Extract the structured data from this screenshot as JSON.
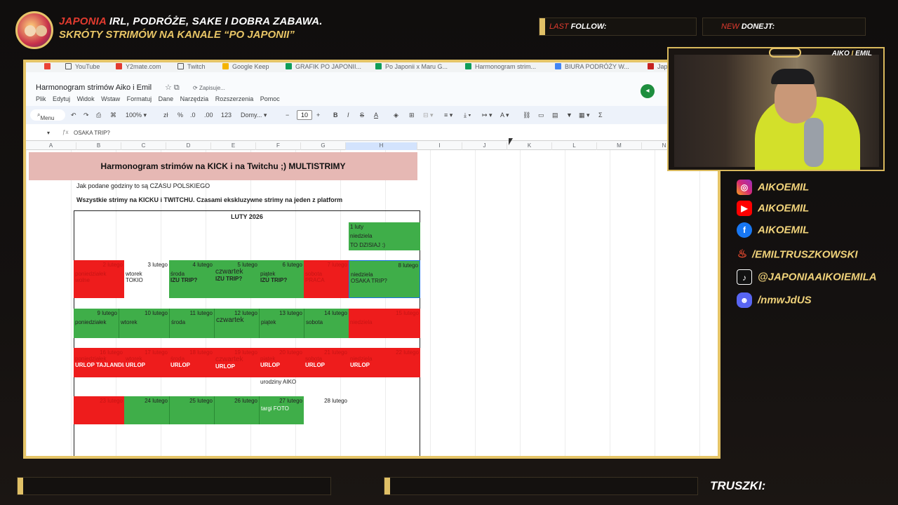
{
  "overlay": {
    "title_red": "JAPONIA",
    "title_rest": " IRL, PODRÓŻE, SAKE I DOBRA ZABAWA.",
    "subtitle": "SKRÓTY STRIMÓW NA KANALE “PO JAPONII”",
    "last_follow_a": "LAST",
    "last_follow_b": "FOLLOW:",
    "donate_a": "NEW",
    "donate_b": "DONEJT:",
    "truszki": "TRUSZKI:",
    "colors": {
      "accent": "#e6c46a",
      "red": "#e23b2f"
    }
  },
  "webcam": {
    "tag_a": "AIKO",
    "tag_mid": " I ",
    "tag_b": "EMIL"
  },
  "socials": [
    {
      "icon": "instagram-icon",
      "handle": "AIKOEMIL"
    },
    {
      "icon": "youtube-icon",
      "handle": "AIKOEMIL"
    },
    {
      "icon": "facebook-icon",
      "handle": "AIKOEMIL"
    },
    {
      "icon": "fire-icon",
      "handle": "/EMILTRUSZKOWSKI"
    },
    {
      "icon": "tiktok-icon",
      "handle": "@JAPONIAAIKOIEMILA"
    },
    {
      "icon": "discord-icon",
      "handle": "/nmwJdUS"
    }
  ],
  "browser": {
    "bookmarks": [
      "YouTube",
      "Y2mate.com",
      "Twitch",
      "Google Keep",
      "GRAFIK PO JAPONII...",
      "Po Japonii x Maru G...",
      "Harmonogram strim...",
      "BIURA PODRÓŻY W...",
      "Jap"
    ]
  },
  "sheets": {
    "doc_title": "Harmonogram strimów Aiko i Emil",
    "save_status": "Zapisuje...",
    "menu": [
      "Plik",
      "Edytuj",
      "Widok",
      "Wstaw",
      "Formatuj",
      "Dane",
      "Narzędzia",
      "Rozszerzenia",
      "Pomoc"
    ],
    "toolbar": {
      "menu": "Menu",
      "zoom": "100%",
      "percent": "%",
      "dec1": ".0",
      "dec2": ".00",
      "num": "123",
      "font": "Domy...",
      "font_size": "10"
    },
    "formula_value": "OSAKA TRIP?",
    "columns": [
      "A",
      "B",
      "C",
      "D",
      "E",
      "F",
      "G",
      "H",
      "I",
      "J",
      "K",
      "L",
      "M",
      "N"
    ],
    "banner": "Harmonogram strimów na KICK  i  na Twitchu ;) MULTISTRIMY",
    "note1": "Jak podane godziny to są CZASU POLSKIEGO",
    "note2": "Wszystkie strimy na KICKU i TWITCHU. Czasami ekskluzywne strimy na jeden z platform",
    "month": "LUTY 2026",
    "week0": {
      "date": "1 luty",
      "day": "niedziela",
      "note": "TO DZISIAJ :)"
    },
    "week1": {
      "dates": [
        "2 lutego",
        "3 lutego",
        "4 lutego",
        "5 lutego",
        "6 lutego",
        "7 lutego",
        "8 lutego"
      ],
      "days": [
        "poniedziałek",
        "wtorek",
        "środa",
        "czwartek",
        "piątek",
        "sobota",
        "niedziela"
      ],
      "notes": [
        "wolne",
        "TOKIO",
        "IZU TRIP?",
        "IZU TRIP?",
        "IZU TRIP?",
        "PRACA",
        "OSAKA TRIP?"
      ]
    },
    "week2": {
      "dates": [
        "9 lutego",
        "10 lutego",
        "11 lutego",
        "12 lutego",
        "13 lutego",
        "14 lutego",
        "15 lutego"
      ],
      "days": [
        "poniedziałek",
        "wtorek",
        "środa",
        "czwartek",
        "piątek",
        "sobota",
        "niedziela"
      ]
    },
    "week3": {
      "dates": [
        "16 lutego",
        "17 lutego",
        "18 lutego",
        "19 lutego",
        "20 lutego",
        "21 lutego",
        "22 lutego"
      ],
      "days": [
        "poniedziałek",
        "wtorek",
        "środa",
        "czwartek",
        "piątek",
        "sobota",
        "niedziela"
      ],
      "notes": [
        "URLOP TAJLANDIA",
        "URLOP",
        "URLOP",
        "URLOP",
        "URLOP",
        "URLOP",
        "URLOP"
      ],
      "extra": "urodziny AIKO"
    },
    "week4": {
      "dates": [
        "23 lutego",
        "24 lutego",
        "25 lutego",
        "26 lutego",
        "27 lutego",
        "28 lutego"
      ],
      "note": "targi FOTO"
    }
  }
}
